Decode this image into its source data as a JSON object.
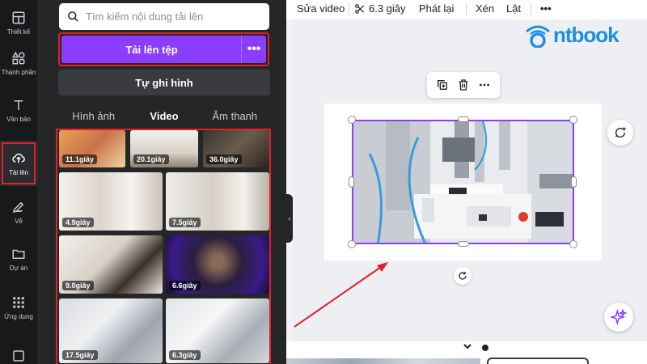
{
  "rail": {
    "items": [
      {
        "label": "Thiết kế",
        "icon": "layout-icon"
      },
      {
        "label": "Thành phần",
        "icon": "shapes-icon"
      },
      {
        "label": "Văn bản",
        "icon": "text-icon"
      },
      {
        "label": "Tải lên",
        "icon": "cloud-upload-icon",
        "active": true
      },
      {
        "label": "Vẽ",
        "icon": "pen-icon"
      },
      {
        "label": "Dự án",
        "icon": "folder-icon"
      },
      {
        "label": "Ứng dụng",
        "icon": "apps-grid-icon"
      }
    ]
  },
  "panel": {
    "search_placeholder": "Tìm kiếm nội dung tải lên",
    "upload_label": "Tải lên tệp",
    "upload_more": "•••",
    "record_label": "Tự ghi hình",
    "tabs": [
      {
        "label": "Hình ảnh",
        "active": false
      },
      {
        "label": "Video",
        "active": true
      },
      {
        "label": "Âm thanh",
        "active": false
      }
    ],
    "videos": [
      {
        "duration": "11.1giây"
      },
      {
        "duration": "20.1giây"
      },
      {
        "duration": "36.0giây"
      },
      {
        "duration": "4.9giây"
      },
      {
        "duration": "7.5giây"
      },
      {
        "duration": "9.0giây"
      },
      {
        "duration": "6.6giây"
      },
      {
        "duration": "17.5giây"
      },
      {
        "duration": "6.3giây"
      }
    ]
  },
  "toolbar": {
    "edit_video": "Sửa video",
    "duration": "6.3 giây",
    "play": "Phát lại",
    "crop": "Xén",
    "flip": "Lật",
    "more": "•••"
  },
  "brand": {
    "text": "ntbook"
  },
  "colors": {
    "accent": "#8b3dff",
    "highlight": "#e0202a",
    "brand": "#1b8fe6",
    "panel_bg": "#252627",
    "rail_bg": "#18191b"
  }
}
